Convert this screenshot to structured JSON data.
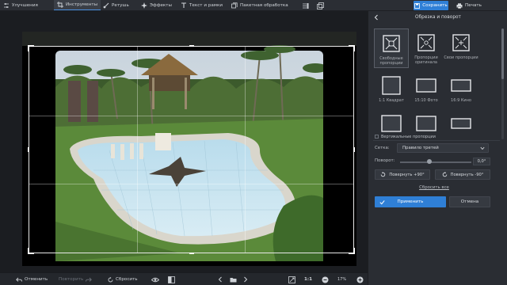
{
  "toolbar": {
    "items": [
      {
        "label": "Улучшения",
        "icon": "sliders-icon"
      },
      {
        "label": "Инструменты",
        "icon": "crop-icon",
        "active": true
      },
      {
        "label": "Ретушь",
        "icon": "brush-icon"
      },
      {
        "label": "Эффекты",
        "icon": "sparkle-icon"
      },
      {
        "label": "Текст и рамки",
        "icon": "text-icon"
      },
      {
        "label": "Пакетная обработка",
        "icon": "batch-icon"
      }
    ],
    "save_label": "Сохранить",
    "print_label": "Печать",
    "accent": "#2f7fd6"
  },
  "bottom": {
    "undo_label": "Отменить",
    "redo_label": "Повторить",
    "reset_label": "Сбросить",
    "zoom_value": "17%",
    "fit_label": "1:1"
  },
  "panel": {
    "title": "Обрезка и поворот",
    "presets": [
      {
        "label": "Свободные пропорции",
        "icon": "free-crop-icon",
        "selected": true
      },
      {
        "label": "Пропорции оригинала",
        "icon": "original-ratio-icon"
      },
      {
        "label": "Свои пропорции",
        "icon": "custom-ratio-icon"
      },
      {
        "label": "1:1 Квадрат",
        "icon": "square-ratio-icon"
      },
      {
        "label": "15:10 Фото",
        "icon": "photo-ratio-icon"
      },
      {
        "label": "16:9 Кино",
        "icon": "cinema-ratio-icon"
      },
      {
        "label": "",
        "icon": "portrait-ratio-icon"
      },
      {
        "label": "",
        "icon": "landscape-ratio-icon"
      },
      {
        "label": "",
        "icon": "wide-ratio-icon"
      }
    ],
    "vertical_label": "Вертикальные пропорции",
    "grid_label": "Сетка:",
    "grid_value": "Правило третей",
    "rotation_label": "Поворот:",
    "rotation_value": "0,0°",
    "rotate_left_label": "Повернуть +90°",
    "rotate_right_label": "Повернуть -90°",
    "reset_all_label": "Сбросить все",
    "apply_label": "Применить",
    "cancel_label": "Отмена"
  }
}
